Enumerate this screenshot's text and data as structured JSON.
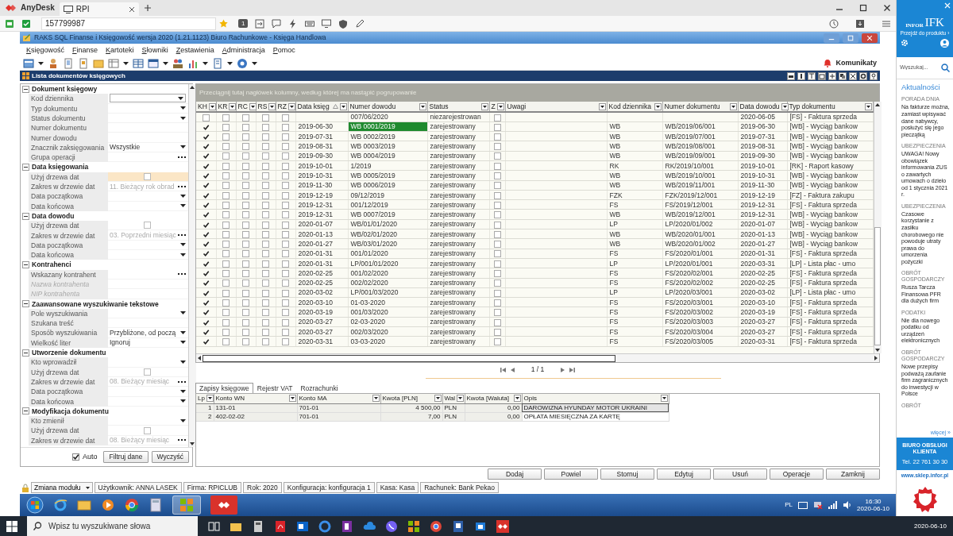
{
  "anydesk": {
    "app": "AnyDesk",
    "tab": "RPI",
    "address": "157799987",
    "display": "1"
  },
  "window": {
    "title": "RAKS SQL Finanse i Księgowość wersja 2020 (1.21.1123) Biuro Rachunkowe - Księga Handlowa"
  },
  "menu": [
    "Księgowość",
    "Finanse",
    "Kartoteki",
    "Słowniki",
    "Zestawienia",
    "Administracja",
    "Pomoc"
  ],
  "notifications": "Komunikaty",
  "panel_title": "Lista dokumentów księgowych",
  "filter_groups": [
    {
      "title": "Dokument księgowy",
      "expanded": true,
      "fields": [
        {
          "label": "Kod dziennika",
          "kind": "combo",
          "disabled": false,
          "selected": false
        },
        {
          "label": "Typ dokumentu",
          "kind": "dropdown",
          "disabled": false,
          "selected": false
        },
        {
          "label": "Status dokumentu",
          "kind": "dropdown",
          "disabled": false,
          "selected": false
        },
        {
          "label": "Numer dokumentu",
          "kind": "text",
          "disabled": false,
          "selected": false
        },
        {
          "label": "Numer dowodu",
          "kind": "text",
          "disabled": false,
          "selected": false
        },
        {
          "label": "Znacznik zaksięgowania",
          "kind": "dropdown",
          "value": "Wszystkie",
          "disabled": false,
          "selected": false
        },
        {
          "label": "Grupa operacji",
          "kind": "ellipsis",
          "disabled": false,
          "selected": false
        }
      ]
    },
    {
      "title": "Data księgowania",
      "expanded": true,
      "fields": [
        {
          "label": "Użyj drzewa dat",
          "kind": "checkbox",
          "checked": false,
          "disabled": false,
          "selected": true
        },
        {
          "label": "Zakres w drzewie dat",
          "kind": "ellipsis",
          "value": "11. Bieżący rok obrad",
          "disabled": true,
          "selected": false
        },
        {
          "label": "Data początkowa",
          "kind": "dropdown",
          "disabled": false,
          "selected": false
        },
        {
          "label": "Data końcowa",
          "kind": "dropdown",
          "disabled": false,
          "selected": false
        }
      ]
    },
    {
      "title": "Data dowodu",
      "expanded": true,
      "fields": [
        {
          "label": "Użyj drzewa dat",
          "kind": "checkbox",
          "checked": false,
          "disabled": false,
          "selected": false
        },
        {
          "label": "Zakres w drzewie dat",
          "kind": "ellipsis",
          "value": "03. Poprzedni miesiąc",
          "disabled": true,
          "selected": false
        },
        {
          "label": "Data początkowa",
          "kind": "dropdown",
          "disabled": false,
          "selected": false
        },
        {
          "label": "Data końcowa",
          "kind": "dropdown",
          "disabled": false,
          "selected": false
        }
      ]
    },
    {
      "title": "Kontrahenci",
      "expanded": true,
      "fields": [
        {
          "label": "Wskazany kontrahent",
          "kind": "ellipsis",
          "disabled": false,
          "selected": false
        },
        {
          "label": "Nazwa kontrahenta",
          "kind": "text",
          "disabled": true,
          "selected": false
        },
        {
          "label": "NIP kontrahenta",
          "kind": "text",
          "disabled": true,
          "selected": false
        }
      ]
    },
    {
      "title": "Zaawansowane wyszukiwanie tekstowe",
      "expanded": true,
      "fields": [
        {
          "label": "Pole wyszukiwania",
          "kind": "dropdown",
          "disabled": false,
          "selected": false
        },
        {
          "label": "Szukana treść",
          "kind": "text",
          "disabled": false,
          "selected": false
        },
        {
          "label": "Sposób wyszukiwania",
          "kind": "dropdown",
          "value": "Przybliżone, od począ",
          "disabled": false,
          "selected": false
        },
        {
          "label": "Wielkość liter",
          "kind": "dropdown",
          "value": "Ignoruj",
          "disabled": false,
          "selected": false
        }
      ]
    },
    {
      "title": "Utworzenie dokumentu",
      "expanded": true,
      "fields": [
        {
          "label": "Kto wprowadził",
          "kind": "dropdown",
          "disabled": false,
          "selected": false
        },
        {
          "label": "Użyj drzewa dat",
          "kind": "checkbox",
          "checked": false,
          "disabled": false,
          "selected": false
        },
        {
          "label": "Zakres w drzewie dat",
          "kind": "ellipsis",
          "value": "08. Bieżący miesiąc",
          "disabled": true,
          "selected": false
        },
        {
          "label": "Data początkowa",
          "kind": "dropdown",
          "disabled": false,
          "selected": false
        },
        {
          "label": "Data końcowa",
          "kind": "dropdown",
          "disabled": false,
          "selected": false
        }
      ]
    },
    {
      "title": "Modyfikacja dokumentu",
      "expanded": true,
      "fields": [
        {
          "label": "Kto zmienił",
          "kind": "dropdown",
          "disabled": false,
          "selected": false
        },
        {
          "label": "Użyj drzewa dat",
          "kind": "checkbox",
          "checked": false,
          "disabled": false,
          "selected": false
        },
        {
          "label": "Zakres w drzewie dat",
          "kind": "ellipsis",
          "value": "08. Bieżący miesiąc",
          "disabled": true,
          "selected": false
        }
      ]
    }
  ],
  "filter_footer": {
    "auto_label": "Auto",
    "auto_checked": true,
    "buttons": [
      "Filtruj dane",
      "Wyczyść"
    ]
  },
  "group_hint": "Przeciągnij tutaj nagłówek kolumny, według której ma nastąpić pogrupowanie",
  "columns": [
    {
      "label": "KH",
      "sorted": false
    },
    {
      "label": "KR",
      "sorted": false
    },
    {
      "label": "RC",
      "sorted": false
    },
    {
      "label": "RS",
      "sorted": false
    },
    {
      "label": "RZ",
      "sorted": false
    },
    {
      "label": "Data księg",
      "sorted": true
    },
    {
      "label": "Numer dowodu",
      "sorted": false
    },
    {
      "label": "Status",
      "sorted": false
    },
    {
      "label": "Z",
      "sorted": false
    },
    {
      "label": "Uwagi",
      "sorted": false
    },
    {
      "label": "Kod dziennika",
      "sorted": false
    },
    {
      "label": "Numer dokumentu",
      "sorted": false
    },
    {
      "label": "Data dowodu",
      "sorted": false
    },
    {
      "label": "Typ dokumentu",
      "sorted": false
    }
  ],
  "rows": [
    {
      "kh": false,
      "kr": false,
      "rc": false,
      "rs": false,
      "rz": false,
      "proof": "007/06/2020",
      "status": "niezarejestrowan",
      "z": false,
      "proof_date": "2020-06-05",
      "type": "[FS] - Faktura sprzeda",
      "selected": false
    },
    {
      "kh": true,
      "kr": false,
      "rc": false,
      "rs": false,
      "rz": false,
      "date": "2019-06-30",
      "proof": "WB 0001/2019",
      "status": "zarejestrowany",
      "z": false,
      "journal": "WB",
      "doc": "WB/2019/06/001",
      "proof_date": "2019-06-30",
      "type": "[WB] - Wyciąg bankow",
      "selected": true
    },
    {
      "kh": true,
      "kr": false,
      "rc": false,
      "rs": false,
      "rz": false,
      "date": "2019-07-31",
      "proof": "WB 0002/2019",
      "status": "zarejestrowany",
      "z": false,
      "journal": "WB",
      "doc": "WB/2019/07/001",
      "proof_date": "2019-07-31",
      "type": "[WB] - Wyciąg bankow",
      "selected": false
    },
    {
      "kh": true,
      "kr": false,
      "rc": false,
      "rs": false,
      "rz": false,
      "date": "2019-08-31",
      "proof": "WB 0003/2019",
      "status": "zarejestrowany",
      "z": false,
      "journal": "WB",
      "doc": "WB/2019/08/001",
      "proof_date": "2019-08-31",
      "type": "[WB] - Wyciąg bankow",
      "selected": false
    },
    {
      "kh": true,
      "kr": false,
      "rc": false,
      "rs": false,
      "rz": false,
      "date": "2019-09-30",
      "proof": "WB 0004/2019",
      "status": "zarejestrowany",
      "z": false,
      "journal": "WB",
      "doc": "WB/2019/09/001",
      "proof_date": "2019-09-30",
      "type": "[WB] - Wyciąg bankow",
      "selected": false
    },
    {
      "kh": true,
      "kr": false,
      "rc": false,
      "rs": false,
      "rz": false,
      "date": "2019-10-01",
      "proof": "1/2019",
      "status": "zarejestrowany",
      "z": false,
      "journal": "RK",
      "doc": "RK/2019/10/001",
      "proof_date": "2019-10-01",
      "type": "[RK] - Raport kasowy",
      "selected": false
    },
    {
      "kh": true,
      "kr": false,
      "rc": false,
      "rs": false,
      "rz": false,
      "date": "2019-10-31",
      "proof": "WB 0005/2019",
      "status": "zarejestrowany",
      "z": false,
      "journal": "WB",
      "doc": "WB/2019/10/001",
      "proof_date": "2019-10-31",
      "type": "[WB] - Wyciąg bankow",
      "selected": false
    },
    {
      "kh": true,
      "kr": false,
      "rc": false,
      "rs": false,
      "rz": false,
      "date": "2019-11-30",
      "proof": "WB 0006/2019",
      "status": "zarejestrowany",
      "z": false,
      "journal": "WB",
      "doc": "WB/2019/11/001",
      "proof_date": "2019-11-30",
      "type": "[WB] - Wyciąg bankow",
      "selected": false
    },
    {
      "kh": true,
      "kr": false,
      "rc": false,
      "rs": false,
      "rz": false,
      "date": "2019-12-19",
      "proof": "09/12/2019",
      "status": "zarejestrowany",
      "z": false,
      "journal": "FZK",
      "doc": "FZK/2019/12/001",
      "proof_date": "2019-12-19",
      "type": "[FZ] - Faktura zakupu",
      "selected": false
    },
    {
      "kh": true,
      "kr": false,
      "rc": false,
      "rs": false,
      "rz": false,
      "date": "2019-12-31",
      "proof": "001/12/2019",
      "status": "zarejestrowany",
      "z": false,
      "journal": "FS",
      "doc": "FS/2019/12/001",
      "proof_date": "2019-12-31",
      "type": "[FS] - Faktura sprzeda",
      "selected": false
    },
    {
      "kh": true,
      "kr": false,
      "rc": false,
      "rs": false,
      "rz": false,
      "date": "2019-12-31",
      "proof": "WB 0007/2019",
      "status": "zarejestrowany",
      "z": false,
      "journal": "WB",
      "doc": "WB/2019/12/001",
      "proof_date": "2019-12-31",
      "type": "[WB] - Wyciąg bankow",
      "selected": false
    },
    {
      "kh": true,
      "kr": false,
      "rc": false,
      "rs": false,
      "rz": false,
      "date": "2020-01-07",
      "proof": "WB/01/01/2020",
      "status": "zarejestrowany",
      "z": false,
      "journal": "LP",
      "doc": "LP/2020/01/002",
      "proof_date": "2020-01-07",
      "type": "[WB] - Wyciąg bankow",
      "selected": false
    },
    {
      "kh": true,
      "kr": false,
      "rc": false,
      "rs": false,
      "rz": false,
      "date": "2020-01-13",
      "proof": "WB/02/01/2020",
      "status": "zarejestrowany",
      "z": false,
      "journal": "WB",
      "doc": "WB/2020/01/001",
      "proof_date": "2020-01-13",
      "type": "[WB] - Wyciąg bankow",
      "selected": false
    },
    {
      "kh": true,
      "kr": false,
      "rc": false,
      "rs": false,
      "rz": false,
      "date": "2020-01-27",
      "proof": "WB/03/01/2020",
      "status": "zarejestrowany",
      "z": false,
      "journal": "WB",
      "doc": "WB/2020/01/002",
      "proof_date": "2020-01-27",
      "type": "[WB] - Wyciąg bankow",
      "selected": false
    },
    {
      "kh": true,
      "kr": false,
      "rc": false,
      "rs": false,
      "rz": false,
      "date": "2020-01-31",
      "proof": "001/01/2020",
      "status": "zarejestrowany",
      "z": false,
      "journal": "FS",
      "doc": "FS/2020/01/001",
      "proof_date": "2020-01-31",
      "type": "[FS] - Faktura sprzeda",
      "selected": false
    },
    {
      "kh": true,
      "kr": false,
      "rc": false,
      "rs": false,
      "rz": false,
      "date": "2020-01-31",
      "proof": "LP/001/01/2020",
      "status": "zarejestrowany",
      "z": false,
      "journal": "LP",
      "doc": "LP/2020/01/001",
      "proof_date": "2020-03-31",
      "type": "[LP] - Lista płac - umo",
      "selected": false
    },
    {
      "kh": true,
      "kr": false,
      "rc": false,
      "rs": false,
      "rz": false,
      "date": "2020-02-25",
      "proof": "001/02/2020",
      "status": "zarejestrowany",
      "z": false,
      "journal": "FS",
      "doc": "FS/2020/02/001",
      "proof_date": "2020-02-25",
      "type": "[FS] - Faktura sprzeda",
      "selected": false
    },
    {
      "kh": true,
      "kr": false,
      "rc": false,
      "rs": false,
      "rz": false,
      "date": "2020-02-25",
      "proof": "002/02/2020",
      "status": "zarejestrowany",
      "z": false,
      "journal": "FS",
      "doc": "FS/2020/02/002",
      "proof_date": "2020-02-25",
      "type": "[FS] - Faktura sprzeda",
      "selected": false
    },
    {
      "kh": true,
      "kr": false,
      "rc": false,
      "rs": false,
      "rz": false,
      "date": "2020-03-02",
      "proof": "LP/001/03/2020",
      "status": "zarejestrowany",
      "z": false,
      "journal": "LP",
      "doc": "LP/2020/03/001",
      "proof_date": "2020-03-02",
      "type": "[LP] - Lista płac - umo",
      "selected": false
    },
    {
      "kh": true,
      "kr": false,
      "rc": false,
      "rs": false,
      "rz": false,
      "date": "2020-03-10",
      "proof": "01-03-2020",
      "status": "zarejestrowany",
      "z": false,
      "journal": "FS",
      "doc": "FS/2020/03/001",
      "proof_date": "2020-03-10",
      "type": "[FS] - Faktura sprzeda",
      "selected": false
    },
    {
      "kh": true,
      "kr": false,
      "rc": false,
      "rs": false,
      "rz": false,
      "date": "2020-03-19",
      "proof": "001/03/2020",
      "status": "zarejestrowany",
      "z": false,
      "journal": "FS",
      "doc": "FS/2020/03/002",
      "proof_date": "2020-03-19",
      "type": "[FS] - Faktura sprzeda",
      "selected": false
    },
    {
      "kh": true,
      "kr": false,
      "rc": false,
      "rs": false,
      "rz": false,
      "date": "2020-03-27",
      "proof": "02-03-2020",
      "status": "zarejestrowany",
      "z": false,
      "journal": "FS",
      "doc": "FS/2020/03/003",
      "proof_date": "2020-03-27",
      "type": "[FS] - Faktura sprzeda",
      "selected": false
    },
    {
      "kh": true,
      "kr": false,
      "rc": false,
      "rs": false,
      "rz": false,
      "date": "2020-03-27",
      "proof": "002/03/2020",
      "status": "zarejestrowany",
      "z": false,
      "journal": "FS",
      "doc": "FS/2020/03/004",
      "proof_date": "2020-03-27",
      "type": "[FS] - Faktura sprzeda",
      "selected": false
    },
    {
      "kh": true,
      "kr": false,
      "rc": false,
      "rs": false,
      "rz": false,
      "date": "2020-03-31",
      "proof": "03-03-2020",
      "status": "zarejestrowany",
      "z": false,
      "journal": "FS",
      "doc": "FS/2020/03/005",
      "proof_date": "2020-03-31",
      "type": "[FS] - Faktura sprzeda",
      "selected": false
    }
  ],
  "pager": "1 / 1",
  "detail_tabs": [
    {
      "label": "Zapisy księgowe",
      "selected": true
    },
    {
      "label": "Rejestr VAT",
      "selected": false
    },
    {
      "label": "Rozrachunki",
      "selected": false
    }
  ],
  "entry_columns": [
    "Lp",
    "Konto WN",
    "Konto MA",
    "Kwota [PLN]",
    "Wal",
    "Kwota [Waluta]",
    "Opis"
  ],
  "entries": [
    {
      "lp": "1",
      "debit": "131-01",
      "credit": "701-01",
      "amount": "4 500,00",
      "currency": "PLN",
      "foreign": "0,00",
      "description": "DAROWIZNA HYUNDAY MOTOR UKRAINI",
      "selected": true
    },
    {
      "lp": "2",
      "debit": "402-02-02",
      "credit": "701-01",
      "amount": "7,00",
      "currency": "PLN",
      "foreign": "0,00",
      "description": "OPŁATA MIESIĘCZNA ZA KARTĘ",
      "selected": false
    }
  ],
  "actions": [
    "Dodaj",
    "Powiel",
    "Stornuj",
    "Edytuj",
    "Usuń",
    "Operacje",
    "Zamknij"
  ],
  "status_bar": {
    "module": "Zmiana modułu",
    "items": [
      "Użytkownik: ANNA LASEK",
      "Firma: RPICLUB",
      "Rok: 2020",
      "Konfiguracja: konfiguracja 1",
      "Kasa: Kasa",
      "Rachunek: Bank Pekao"
    ]
  },
  "remote_taskbar": {
    "language": "PL",
    "time": "16:30",
    "date": "2020-06-10"
  },
  "sidebar": {
    "logo": [
      "INFOR",
      "IFK"
    ],
    "product_link": "Przejdź do produktu ›",
    "search_placeholder": "Wyszukaj...",
    "heading": "Aktualności",
    "news": [
      {
        "category": "PORADA DNIA",
        "text": "Na fakturze można, zamiast wpisywać dane nabywcy, posłużyć się jego pieczątką"
      },
      {
        "category": "UBEZPIECZENIA",
        "text": "UWAGA! Nowy obowiązek informowania ZUS o zawartych umowach o dzieło od 1 stycznia 2021 r."
      },
      {
        "category": "UBEZPIECZENIA",
        "text": "Czasowe korzystanie z zasiłku chorobowego nie powoduje utraty prawa do umorzenia pożyczki"
      },
      {
        "category": "OBRÓT GOSPODARCZY",
        "text": "Rusza Tarcza Finansowa PFR dla dużych firm"
      },
      {
        "category": "PODATKI",
        "text": "Nie dla nowego podatku od urządzeń elektronicznych"
      },
      {
        "category": "OBRÓT GOSPODARCZY",
        "text": "Nowe przepisy podważą zaufanie firm zagranicznych do inwestycji w Polsce"
      },
      {
        "category": "OBRÓT"
      }
    ],
    "more": "więcej »",
    "support": "BIURO OBSŁUGI KLIENTA",
    "phone": "Tel. 22 761 30 30",
    "shop": "www.sklep.infor.pl"
  },
  "taskbar": {
    "search_placeholder": "Wpisz tu wyszukiwane słowa",
    "date": "2020-06-10"
  }
}
